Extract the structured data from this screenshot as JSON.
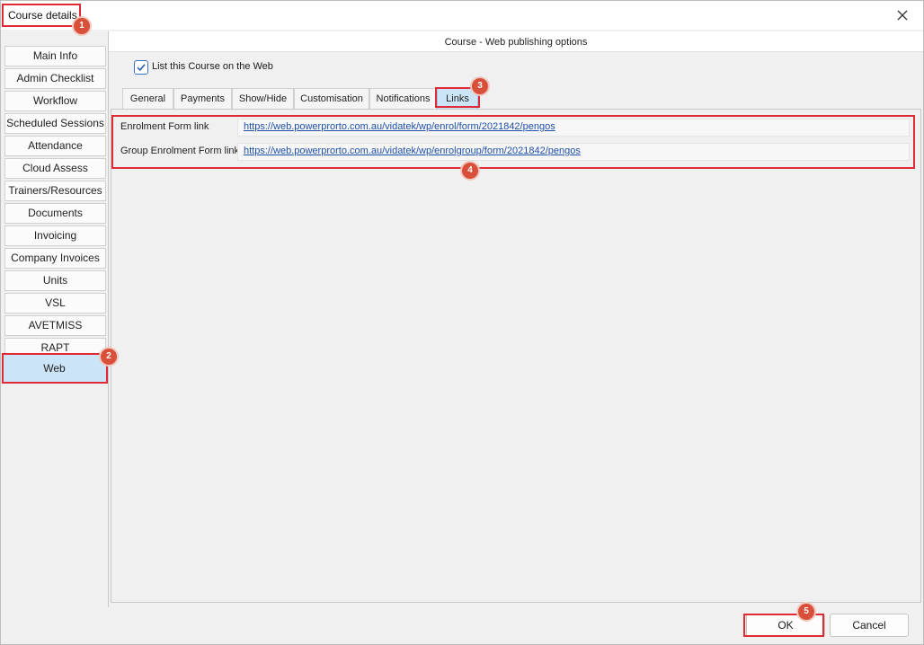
{
  "window": {
    "title": "Course details"
  },
  "sidebar": {
    "items": [
      {
        "label": "Main Info"
      },
      {
        "label": "Admin Checklist"
      },
      {
        "label": "Workflow"
      },
      {
        "label": "Scheduled Sessions"
      },
      {
        "label": "Attendance"
      },
      {
        "label": "Cloud Assess"
      },
      {
        "label": "Trainers/Resources"
      },
      {
        "label": "Documents"
      },
      {
        "label": "Invoicing"
      },
      {
        "label": "Company Invoices"
      },
      {
        "label": "Units"
      },
      {
        "label": "VSL"
      },
      {
        "label": "AVETMISS"
      },
      {
        "label": "RAPT"
      },
      {
        "label": "Web"
      }
    ],
    "active": "Web"
  },
  "panel": {
    "header": "Course - Web publishing options",
    "list_on_web_label": "List this Course on the Web",
    "list_on_web_checked": true,
    "tabs": [
      {
        "label": "General"
      },
      {
        "label": "Payments"
      },
      {
        "label": "Show/Hide"
      },
      {
        "label": "Customisation"
      },
      {
        "label": "Notifications"
      },
      {
        "label": "Links"
      }
    ],
    "active_tab": "Links",
    "links": {
      "enrolment_label": "Enrolment Form link",
      "enrolment_url": "https://web.powerprorto.com.au/vidatek/wp/enrol/form/2021842/pengos",
      "group_label": "Group Enrolment Form link",
      "group_url": "https://web.powerprorto.com.au/vidatek/wp/enrolgroup/form/2021842/pengos"
    }
  },
  "buttons": {
    "ok": "OK",
    "cancel": "Cancel"
  },
  "callouts": [
    "1",
    "2",
    "3",
    "4",
    "5"
  ],
  "colors": {
    "callout_red": "#e02b36",
    "badge": "#d9503a",
    "active_blue": "#cce4f7",
    "link_blue": "#1f4fa8"
  }
}
